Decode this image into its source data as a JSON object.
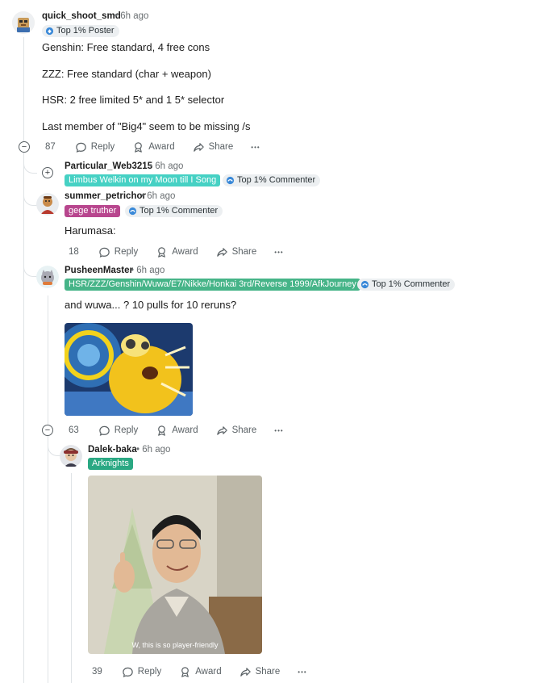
{
  "comments": [
    {
      "username": "quick_shoot_smd",
      "time": "6h ago",
      "badge": "Top 1% Poster",
      "body": [
        "Genshin: Free standard, 4 free cons",
        "ZZZ: Free standard (char + weapon)",
        "HSR: 2 free limited 5* and 1 5* selector",
        "Last member of \"Big4\" seem to be missing /s"
      ],
      "votes": "87"
    },
    {
      "username": "Particular_Web3215",
      "time": "6h ago",
      "flair": "Limbus Welkin on my Moon till I Song",
      "badge": "Top 1% Commenter"
    },
    {
      "username": "summer_petrichor",
      "time": "6h ago",
      "flair": "gege truther",
      "badge": "Top 1% Commenter",
      "body": "Harumasa:",
      "votes": "18"
    },
    {
      "username": "PusheenMaster",
      "time": "6h ago",
      "flair": "HSR/ZZZ/Genshin/Wuwa/E7/Nikke/Honkai 3rd/Reverse 1999/AfkJourney",
      "badge": "Top 1% Commenter",
      "body": "and wuwa... ? 10 pulls for 10 reruns?",
      "votes": "63"
    },
    {
      "username": "Dalek-baka",
      "time": "6h ago",
      "flair": "Arknights",
      "caption": "W, this is so player-friendly",
      "votes": "39"
    }
  ],
  "actions": {
    "reply": "Reply",
    "award": "Award",
    "share": "Share",
    "more": "•••"
  },
  "colors": {
    "flair_teal": "#46d1c4",
    "flair_pink": "#b8468e",
    "flair_green": "#46b488",
    "thread_line": "#dfe3e6"
  },
  "separator": "•",
  "toggles": {
    "collapse": "−",
    "expand": "+"
  }
}
